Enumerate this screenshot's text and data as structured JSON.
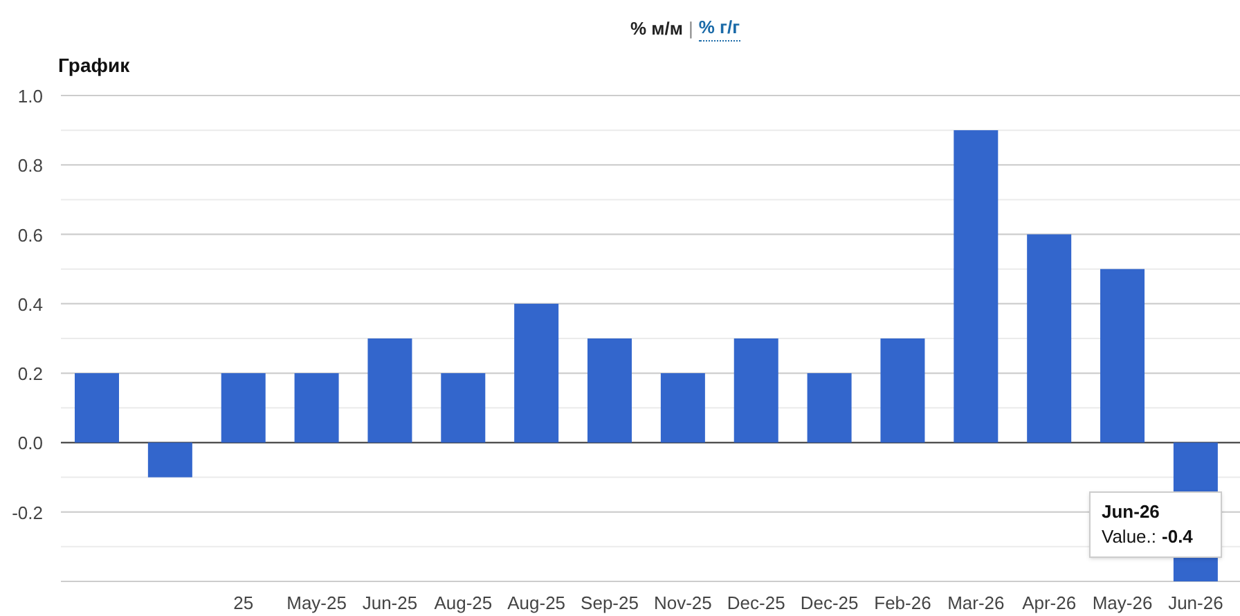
{
  "tabs": [
    {
      "label": "% м/м",
      "selected": true
    },
    {
      "label": "% г/г",
      "selected": false
    }
  ],
  "separator": "|",
  "title": "График",
  "chart": {
    "chart_data": {
      "type": "bar",
      "categories": [
        null,
        null,
        "25",
        "May-25",
        "Jun-25",
        "Aug-25",
        "Aug-25",
        "Sep-25",
        "Nov-25",
        "Dec-25",
        "Dec-25",
        "Feb-26",
        "Mar-26",
        "Apr-26",
        "May-26",
        "Jun-26"
      ],
      "grid": true,
      "series": [
        {
          "color": "#3366cc",
          "values": [
            0.2,
            -0.1,
            0.2,
            0.2,
            0.3,
            0.2,
            0.4,
            0.3,
            0.2,
            0.3,
            0.2,
            0.3,
            0.9,
            0.6,
            0.5,
            -0.4
          ]
        }
      ],
      "ylim": [
        -0.4,
        1.0
      ],
      "yticks": [
        {
          "value": -0.2,
          "label": "-0.2"
        },
        {
          "value": 0,
          "label": "0.0"
        },
        {
          "value": 0.2,
          "label": "0.2"
        },
        {
          "value": 0.4,
          "label": "0.4"
        },
        {
          "value": 0.6,
          "label": "0.6"
        },
        {
          "value": 0.8,
          "label": "0.8"
        },
        {
          "value": 1,
          "label": "1.0"
        }
      ]
    }
  },
  "tooltip": {
    "title": "Jun-26",
    "label": "Value.:",
    "value": "-0.4"
  }
}
